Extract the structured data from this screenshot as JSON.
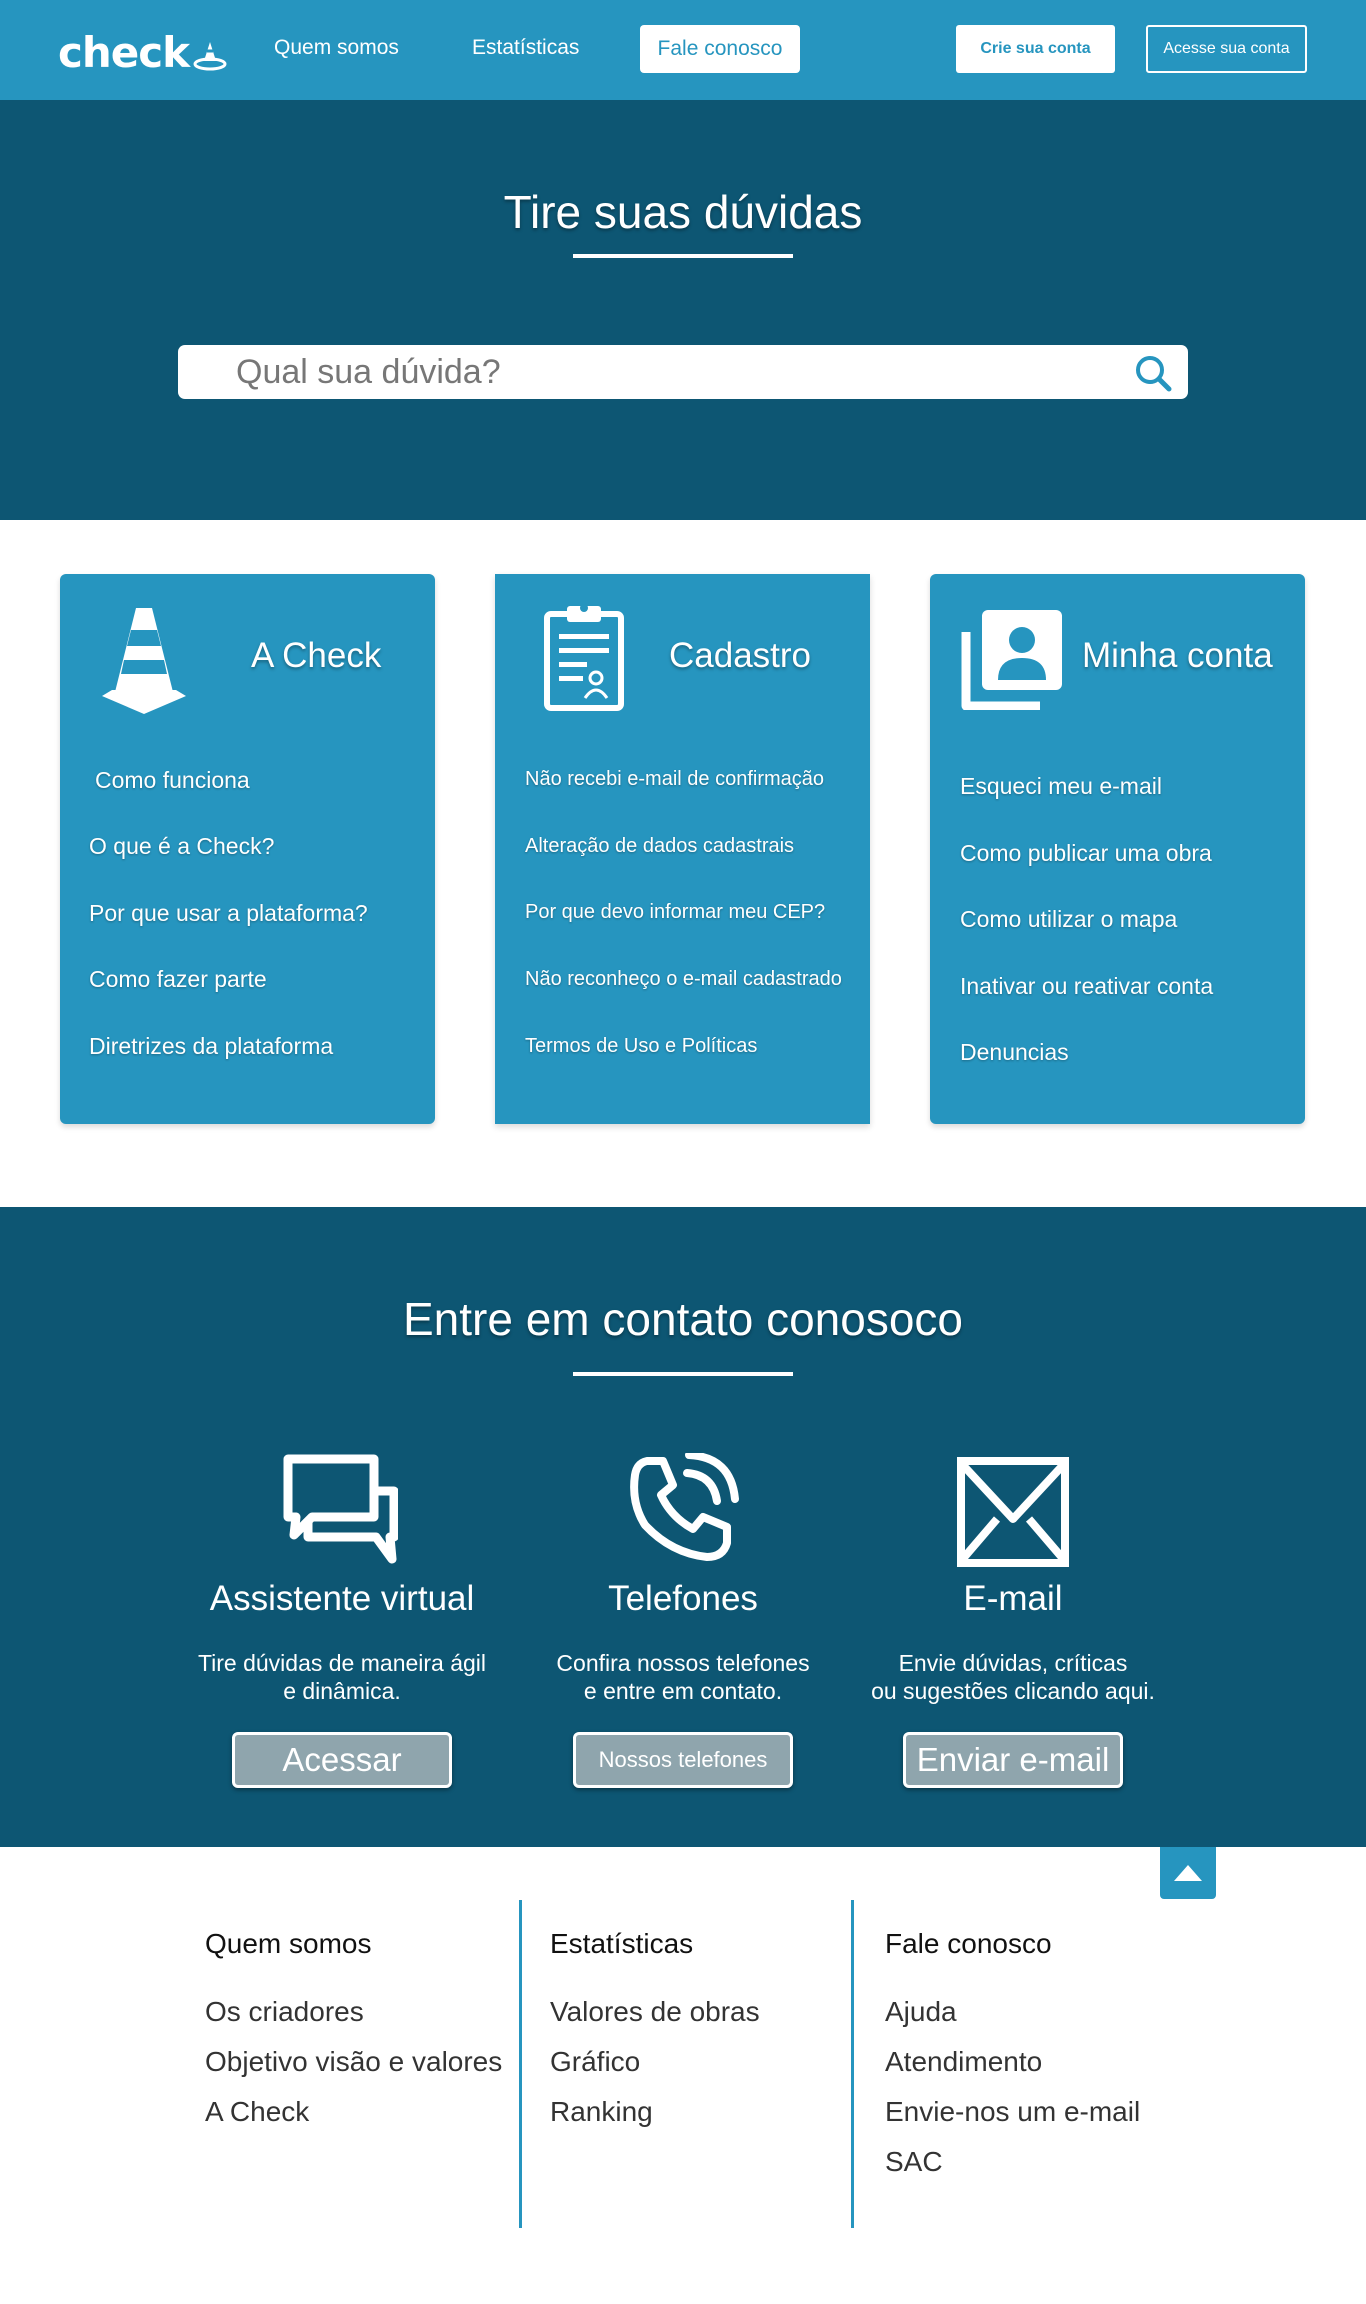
{
  "nav": {
    "logo": "check",
    "links": [
      "Quem somos",
      "Estatísticas"
    ],
    "active_link": "Fale conosco",
    "create_account": "Crie sua conta",
    "access_account": "Acesse sua conta"
  },
  "hero": {
    "title": "Tire suas dúvidas",
    "search_placeholder": "Qual sua dúvida?"
  },
  "cards": [
    {
      "title": "A Check",
      "icon": "traffic-cone-icon",
      "items": [
        "Como funciona",
        "O que é a Check?",
        "Por que usar a plataforma?",
        "Como fazer parte",
        "Diretrizes da plataforma"
      ]
    },
    {
      "title": "Cadastro",
      "icon": "clipboard-user-icon",
      "items": [
        "Não recebi e-mail de confirmação",
        "Alteração de dados cadastrais",
        "Por que devo informar meu CEP?",
        "Não reconheço o e-mail cadastrado",
        "Termos de Uso e Políticas"
      ]
    },
    {
      "title": "Minha conta",
      "icon": "user-profile-icon",
      "items": [
        "Esqueci meu e-mail",
        "Como publicar uma obra",
        "Como utilizar o mapa",
        "Inativar ou reativar conta",
        "Denuncias"
      ]
    }
  ],
  "contact": {
    "title": "Entre em contato conosoco",
    "columns": [
      {
        "title": "Assistente virtual",
        "desc_1": "Tire dúvidas de maneira ágil",
        "desc_2": "e dinâmica.",
        "button": "Acessar",
        "icon": "chat-bubbles-icon"
      },
      {
        "title": "Telefones",
        "desc_1": "Confira nossos telefones",
        "desc_2": "e entre em contato.",
        "button": "Nossos telefones",
        "icon": "phone-icon"
      },
      {
        "title": "E-mail",
        "desc_1": "Envie dúvidas, críticas",
        "desc_2": "ou sugestões clicando aqui.",
        "button": "Enviar e-mail",
        "icon": "envelope-icon"
      }
    ]
  },
  "footer": {
    "columns": [
      {
        "heading": "Quem somos",
        "links": [
          "Os criadores",
          "Objetivo visão e valores",
          "A Check"
        ]
      },
      {
        "heading": "Estatísticas",
        "links": [
          "Valores de obras",
          "Gráfico",
          "Ranking"
        ]
      },
      {
        "heading": "Fale conosco",
        "links": [
          "Ajuda",
          "Atendimento",
          "Envie-nos um e-mail",
          "SAC"
        ]
      }
    ]
  },
  "colors": {
    "primary": "#2695bf",
    "dark": "#0d5673",
    "button_gray": "#8fa5ad"
  }
}
